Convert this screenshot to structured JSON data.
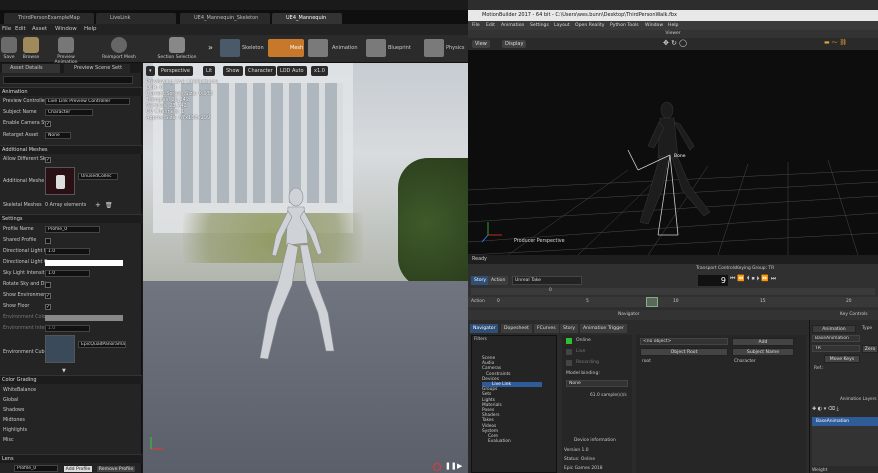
{
  "unreal": {
    "tabs": [
      "ThirdPersonExampleMap",
      "LiveLink",
      "UE4_Mannequin_Skeleton",
      "UE4_Mannequin"
    ],
    "menu": [
      "File",
      "Edit",
      "Asset",
      "Window",
      "Help"
    ],
    "toolbar": [
      "Save",
      "Browse",
      "Preview Animation",
      "Reimport Mesh",
      "Section Selection"
    ],
    "modes": [
      "Skeleton",
      "Mesh",
      "Animation",
      "Blueprint",
      "Physics"
    ],
    "panel_tabs": [
      "Asset Details",
      "Preview Scene Sett"
    ],
    "sections": {
      "animation": {
        "title": "Animation",
        "preview_controller_label": "Preview Controlle",
        "preview_controller_value": "Live Link Preview Controller",
        "subject_name_label": "Subject Name",
        "subject_name_value": "Character",
        "enable_camera_label": "Enable Camera Sy",
        "retarget_asset_label": "Retarget Asset",
        "retarget_asset_value": "None"
      },
      "additional_meshes": {
        "title": "Additional Meshes",
        "allow_different_label": "Allow Different Sk",
        "additional_mesh_label": "Additional Meshe",
        "additional_mesh_value": "UnusedCollec",
        "skeletal_meshes_label": "Skeletal Meshes",
        "skeletal_meshes_value": "0 Array elements"
      },
      "settings": {
        "title": "Settings",
        "profile_name_label": "Profile Name",
        "profile_name_value": "Profile_0",
        "shared_profile_label": "Shared Profile",
        "directional_light_label": "Directional Light I",
        "directional_light_value": "1.0",
        "directional_light_color_label": "Directional Light C",
        "sky_light_label": "Sky Light Intensit",
        "sky_light_value": "1.0",
        "rotate_sky_label": "Rotate Sky and Di",
        "show_environment_label": "Show Environmen",
        "show_floor_label": "Show Floor",
        "environment_color_label": "Environment Colo",
        "environment_intensity_label": "Environment Inter",
        "environment_intensity_value": "1.0",
        "environment_cube_label": "Environment Cube",
        "environment_cube_value": "EpicQuadPanorama"
      },
      "color_grading": {
        "title": "Color Grading",
        "items": [
          "WhiteBalance",
          "Global",
          "Shadows",
          "Midtones",
          "Highlights",
          "Misc"
        ]
      },
      "lens": {
        "title": "Lens",
        "profile_label": "Profile_0",
        "add_profile": "Add Profile",
        "remove_profile": "Remove Profile"
      }
    },
    "viewport": {
      "buttons": [
        "Perspective",
        "Lit",
        "Show",
        "Character",
        "LOD Auto",
        "x1.0"
      ],
      "stats": [
        "Previewing Live LinkInstance",
        "LOD: 0",
        "Current Screen Size: 0.973",
        "Triangles: 23,242",
        "Vertices: 23,742",
        "UV Channels: 1",
        "Approx Size: 67x136x199"
      ]
    }
  },
  "motionbuilder": {
    "title": "MotionBuilder 2017 - 64 bit - C:\\Users\\wes.bunn\\Desktop\\ThirdPersonWalk.fbx",
    "menu": [
      "File",
      "Edit",
      "Animation",
      "Settings",
      "Layout",
      "Open Reality",
      "Python Tools",
      "Window",
      "Help"
    ],
    "viewer_label": "Viewer",
    "view_buttons": [
      "View",
      "Display"
    ],
    "camera_label": "Producer Perspective",
    "bone_label": "Bone",
    "status": "Ready",
    "transport": {
      "title": "Transport Controls",
      "keying_group": "Keying Group: TR",
      "story_tab": "Story",
      "action_tab": "Action",
      "take": "Unreal Take",
      "frame": "9",
      "ruler_action": "Action",
      "ticks": [
        "0",
        "5",
        "10",
        "15",
        "20"
      ]
    },
    "navigator": {
      "title": "Navigator",
      "tabs": [
        "Navigator",
        "Dopesheet",
        "FCurves",
        "Story",
        "Animation Trigger"
      ],
      "tree": [
        "Scene",
        "Audio",
        "Cameras",
        "Constraints",
        "Devices",
        "Live Link",
        "Groups",
        "Sets",
        "Lights",
        "Materials",
        "Poses",
        "Shaders",
        "Takes",
        "Videos",
        "System",
        "Core",
        "Evaluation"
      ],
      "filter_label": "Filters",
      "online_label": "Online",
      "live_label": "Live",
      "recording_label": "Recording",
      "model_binding_label": "Model binding:",
      "model_binding_value": "None",
      "sample_rate": "61.0 sample(s)/s",
      "device_info": "Device information",
      "version": "Version 1.0",
      "status": "Status: Online",
      "company": "Epic Games 2018",
      "object_select": "<no object>",
      "add_button": "Add",
      "object_root_header": "Object Root",
      "subject_name_header": "Subject Name",
      "object_root_value": "root",
      "subject_name_value": "Character"
    },
    "key_controls": {
      "title": "Key Controls",
      "animation_label": "Animation",
      "type_label": "Type",
      "base_animation": "BaseAnimation",
      "tr_label": "TR",
      "zero_label": "Zero",
      "move_keys": "Move Keys",
      "ref_label": "Ref.:",
      "layers_title": "Animation Layers",
      "layer_item": "BaseAnimation",
      "weight_label": "Weight"
    }
  },
  "colors": {
    "mesh_mode": "#c7782a",
    "mb_select": "#2f5c99",
    "online_green": "#2fbf2f"
  }
}
